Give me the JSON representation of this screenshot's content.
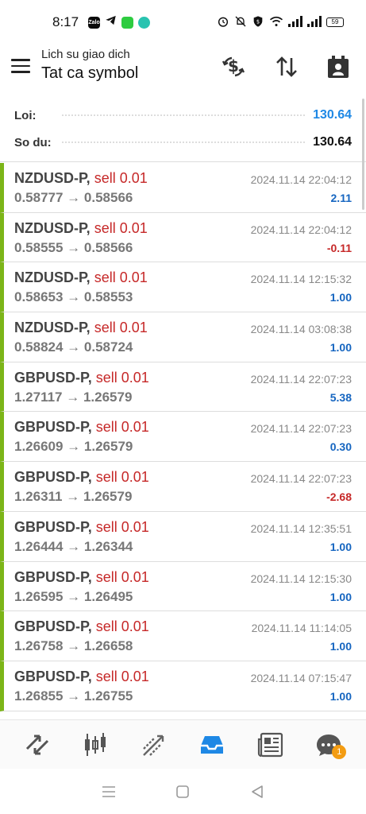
{
  "status_bar": {
    "time": "8:17",
    "apps": [
      {
        "name": "zalo-icon",
        "label": "Zalo",
        "color": "#0b0b0b"
      },
      {
        "name": "telegram-icon",
        "label": "",
        "color": "#111111"
      },
      {
        "name": "green-app-icon",
        "label": "",
        "color": "#2ecc40"
      },
      {
        "name": "chat-app-icon",
        "label": "",
        "color": "#29c3b0"
      }
    ],
    "battery": "59"
  },
  "app_bar": {
    "subtitle": "Lich su giao dich",
    "title": "Tat ca symbol"
  },
  "summary": {
    "profit_label": "Loi:",
    "profit_value": "130.64",
    "balance_label": "So du:",
    "balance_value": "130.64",
    "colors": {
      "profit": "#1e88e5",
      "balance": "#111111"
    }
  },
  "trades": [
    {
      "symbol": "NZDUSD-P,",
      "side": "sell 0.01",
      "prices": "0.58777 → 0.58566",
      "time": "2024.11.14 22:04:12",
      "profit": "2.11",
      "sign": "pos"
    },
    {
      "symbol": "NZDUSD-P,",
      "side": "sell 0.01",
      "prices": "0.58555 → 0.58566",
      "time": "2024.11.14 22:04:12",
      "profit": "-0.11",
      "sign": "neg"
    },
    {
      "symbol": "NZDUSD-P,",
      "side": "sell 0.01",
      "prices": "0.58653 → 0.58553",
      "time": "2024.11.14 12:15:32",
      "profit": "1.00",
      "sign": "pos"
    },
    {
      "symbol": "NZDUSD-P,",
      "side": "sell 0.01",
      "prices": "0.58824 → 0.58724",
      "time": "2024.11.14 03:08:38",
      "profit": "1.00",
      "sign": "pos"
    },
    {
      "symbol": "GBPUSD-P,",
      "side": "sell 0.01",
      "prices": "1.27117 → 1.26579",
      "time": "2024.11.14 22:07:23",
      "profit": "5.38",
      "sign": "pos"
    },
    {
      "symbol": "GBPUSD-P,",
      "side": "sell 0.01",
      "prices": "1.26609 → 1.26579",
      "time": "2024.11.14 22:07:23",
      "profit": "0.30",
      "sign": "pos"
    },
    {
      "symbol": "GBPUSD-P,",
      "side": "sell 0.01",
      "prices": "1.26311 → 1.26579",
      "time": "2024.11.14 22:07:23",
      "profit": "-2.68",
      "sign": "neg"
    },
    {
      "symbol": "GBPUSD-P,",
      "side": "sell 0.01",
      "prices": "1.26444 → 1.26344",
      "time": "2024.11.14 12:35:51",
      "profit": "1.00",
      "sign": "pos"
    },
    {
      "symbol": "GBPUSD-P,",
      "side": "sell 0.01",
      "prices": "1.26595 → 1.26495",
      "time": "2024.11.14 12:15:30",
      "profit": "1.00",
      "sign": "pos"
    },
    {
      "symbol": "GBPUSD-P,",
      "side": "sell 0.01",
      "prices": "1.26758 → 1.26658",
      "time": "2024.11.14 11:14:05",
      "profit": "1.00",
      "sign": "pos"
    },
    {
      "symbol": "GBPUSD-P,",
      "side": "sell 0.01",
      "prices": "1.26855 → 1.26755",
      "time": "2024.11.14 07:15:47",
      "profit": "1.00",
      "sign": "pos"
    }
  ],
  "bottom_nav": {
    "items": [
      "quotes-icon",
      "chart-icon",
      "trade-icon",
      "history-icon",
      "news-icon",
      "messages-icon"
    ],
    "active": "history-icon",
    "active_color": "#1e88e5",
    "messages_badge": "1"
  }
}
